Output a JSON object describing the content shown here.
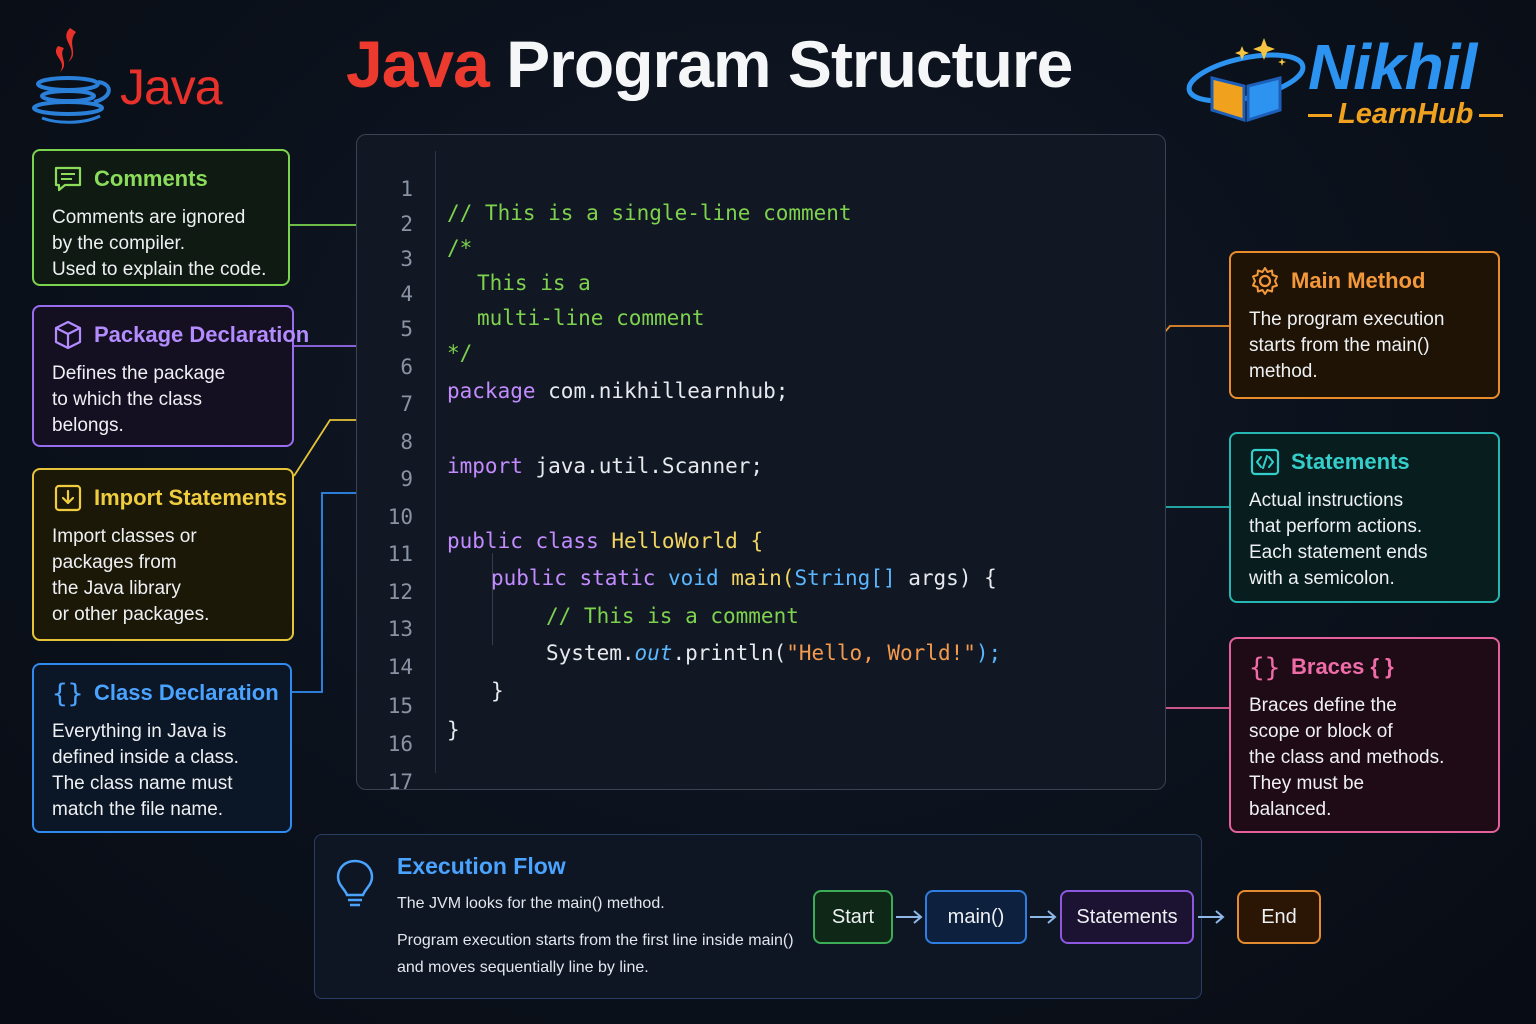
{
  "header": {
    "java_logo_text": "Java",
    "title_part1": "Java",
    "title_part2": "Program Structure",
    "brand_name": "Nikhil",
    "brand_sub": "LearnHub"
  },
  "cards": {
    "comments": {
      "title": "Comments",
      "body": "Comments are ignored\nby the compiler.\nUsed to explain the code.",
      "icon": "comment-icon",
      "color": "#7bd44e"
    },
    "package": {
      "title": "Package Declaration",
      "body": "Defines the package\nto which the class\nbelongs.",
      "icon": "package-cube-icon",
      "color": "#9a6cf0"
    },
    "import": {
      "title": "Import Statements",
      "body": "Import classes or\npackages from\nthe Java library\nor other packages.",
      "icon": "import-arrow-icon",
      "color": "#e5c43a"
    },
    "class": {
      "title": "Class Declaration",
      "body": "Everything in Java is\ndefined inside a class.\nThe class name must\nmatch the file name.",
      "icon": "braces-icon",
      "color": "#2f8bef"
    },
    "main": {
      "title": "Main Method",
      "body": "The program execution\nstarts from the main()\nmethod.",
      "icon": "gear-icon",
      "color": "#e98d2c"
    },
    "statements": {
      "title": "Statements",
      "body": "Actual instructions\nthat perform actions.\nEach statement ends\nwith a semicolon.",
      "icon": "code-tag-icon",
      "color": "#26b7b4"
    },
    "braces": {
      "title": "Braces { }",
      "body": "Braces define the\nscope or block of\nthe class and methods.\nThey must be\nbalanced.",
      "icon": "braces-icon",
      "color": "#e5609c"
    }
  },
  "code": {
    "lines": [
      {
        "n": "1"
      },
      {
        "n": "2"
      },
      {
        "n": "3"
      },
      {
        "n": "4"
      },
      {
        "n": "5"
      },
      {
        "n": "6"
      },
      {
        "n": "7"
      },
      {
        "n": "8"
      },
      {
        "n": "9"
      },
      {
        "n": "10"
      },
      {
        "n": "11"
      },
      {
        "n": "12"
      },
      {
        "n": "13"
      },
      {
        "n": "14"
      },
      {
        "n": "15"
      },
      {
        "n": "16"
      },
      {
        "n": "17"
      }
    ],
    "l1": "// This is a single-line comment",
    "l2": "/*",
    "l3": "This is a",
    "l4": "multi-line comment",
    "l5": "*/",
    "l6_kw": "package",
    "l6_rest": " com.nikhillearnhub;",
    "l8_kw": "import",
    "l8_rest": " java.util.Scanner;",
    "l10_kw": "public class",
    "l10_cls": " HelloWorld",
    "l10_rest": " {",
    "l11_kw": "public static",
    "l11_type": " void",
    "l11_name": " main(",
    "l11_type2": "String[]",
    "l11_rest": " args) {",
    "l12": "// This is a comment",
    "l13_a": "System.",
    "l13_fld": "out",
    "l13_b": ".println(",
    "l13_str": "\"Hello, World!\"",
    "l13_c": ");",
    "l14": "}",
    "l15": "}"
  },
  "execution": {
    "title": "Execution Flow",
    "line1": "The JVM looks for the main() method.",
    "line2": "Program execution starts from the first line inside main() and moves sequentially line by line.",
    "steps": {
      "start": "Start",
      "main": "main()",
      "statements": "Statements",
      "end": "End"
    },
    "icon": "lightbulb-icon"
  }
}
